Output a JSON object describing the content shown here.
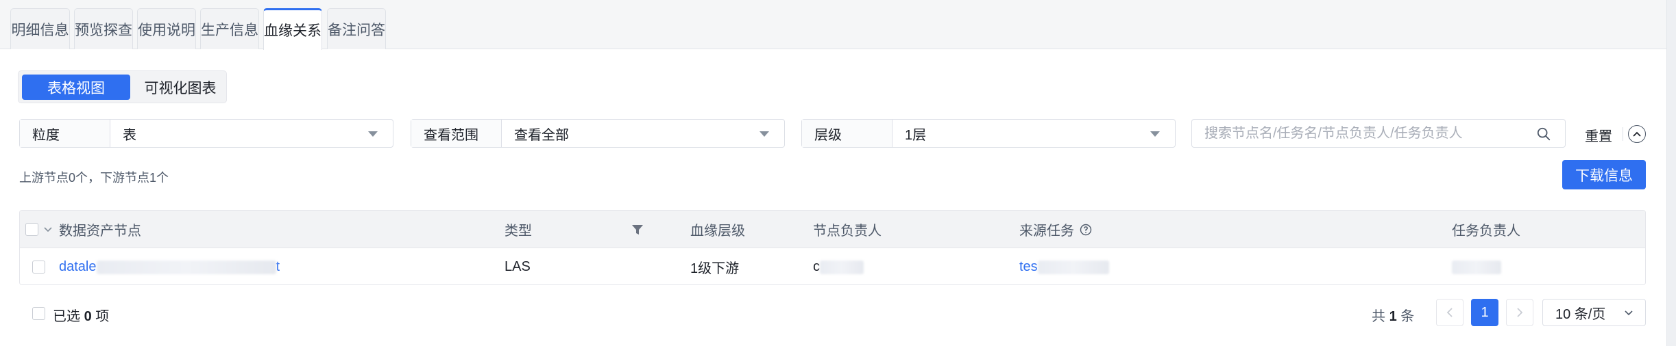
{
  "tabs": [
    "明细信息",
    "预览探查",
    "使用说明",
    "生产信息",
    "血缘关系",
    "备注问答"
  ],
  "active_tab": "血缘关系",
  "view_switch": {
    "table_view": "表格视图",
    "chart_view": "可视化图表"
  },
  "filters": {
    "granularity": {
      "label": "粒度",
      "value": "表"
    },
    "scope": {
      "label": "查看范围",
      "value": "查看全部"
    },
    "level": {
      "label": "层级",
      "value": "1层"
    }
  },
  "search": {
    "placeholder": "搜索节点名/任务名/节点负责人/任务负责人"
  },
  "reset_label": "重置",
  "summary": "上游节点0个，下游节点1个",
  "download_label": "下载信息",
  "table": {
    "headers": {
      "node": "数据资产节点",
      "type": "类型",
      "level": "血缘层级",
      "node_owner": "节点负责人",
      "source_task": "来源任务",
      "task_owner": "任务负责人"
    },
    "rows": [
      {
        "node_prefix": "datale",
        "node_suffix": "t",
        "type": "LAS",
        "level": "1级下游",
        "node_owner": "c",
        "source_task": "tes"
      }
    ]
  },
  "footer": {
    "selected_prefix": "已选",
    "selected_count": "0",
    "selected_suffix": "项",
    "total_prefix": "共",
    "total_count": "1",
    "total_suffix": "条",
    "current_page": "1",
    "page_size": "10 条/页"
  },
  "colors": {
    "primary": "#2f6ff0",
    "text": "#1d2129",
    "muted": "#4e5969",
    "border": "#e5e6eb"
  }
}
